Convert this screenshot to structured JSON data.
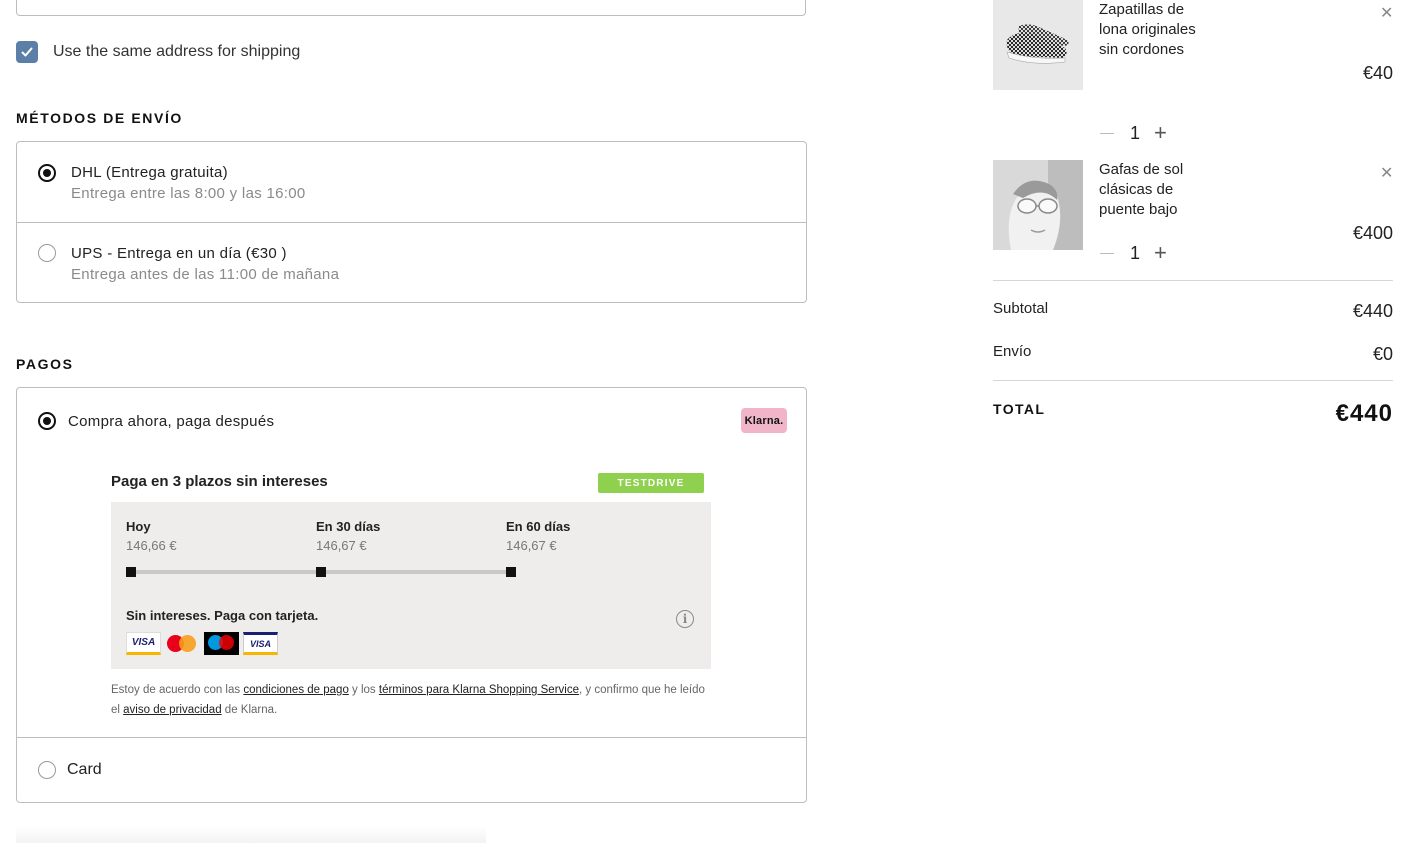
{
  "shipping_address": {
    "same_address_label": "Use the same address for shipping",
    "same_address_checked": true
  },
  "shipping_methods": {
    "title": "MÉTODOS DE ENVÍO",
    "options": [
      {
        "name": "DHL (Entrega gratuita)",
        "detail": "Entrega entre las 8:00 y las 16:00",
        "selected": true
      },
      {
        "name": "UPS - Entrega en un día (€30 )",
        "detail": "Entrega antes de las 11:00 de mañana",
        "selected": false
      }
    ]
  },
  "payments": {
    "title": "PAGOS",
    "klarna": {
      "label": "Compra ahora, paga después",
      "badge": "Klarna.",
      "selected": true,
      "plan_title": "Paga en 3 plazos sin intereses",
      "testdrive": "TESTDRIVE",
      "installments": [
        {
          "label": "Hoy",
          "amount": "146,66 €"
        },
        {
          "label": "En 30 días",
          "amount": "146,67 €"
        },
        {
          "label": "En 60 días",
          "amount": "146,67 €"
        }
      ],
      "no_interest": "Sin intereses. Paga con tarjeta.",
      "card_logos": [
        "VISA",
        "mastercard-icon",
        "maestro-icon",
        "VISA"
      ],
      "terms": {
        "part1": "Estoy de acuerdo con las ",
        "link1": "condiciones de pago",
        "part2": " y los ",
        "link2": "términos para Klarna Shopping Service",
        "part3": ", y confirmo que he leído el ",
        "link3": "aviso de privacidad",
        "part4": " de Klarna."
      }
    },
    "card": {
      "label": "Card",
      "selected": false
    }
  },
  "cart": {
    "items": [
      {
        "name": "Zapatillas de lona originales sin cordones",
        "price": "€40",
        "qty": "1",
        "image": "sneaker-image"
      },
      {
        "name": "Gafas de sol clásicas de puente bajo",
        "price": "€400",
        "qty": "1",
        "image": "sunglasses-image"
      }
    ],
    "subtotal_label": "Subtotal",
    "subtotal": "€440",
    "shipping_label": "Envío",
    "shipping": "€0",
    "total_label": "TOTAL",
    "total": "€440"
  },
  "colors": {
    "checkbox": "#5b7fa6",
    "klarna_pink": "#f0b5c8",
    "testdrive_green": "#8fd14f",
    "panel_bg": "#eeedeb"
  }
}
